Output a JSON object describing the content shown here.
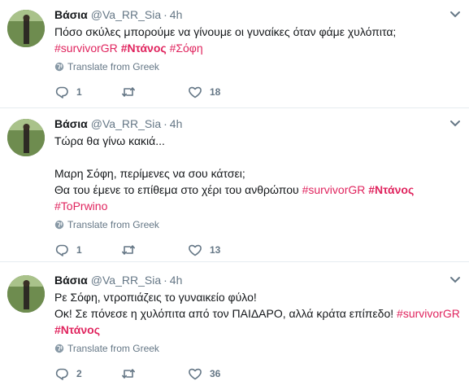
{
  "tweets": [
    {
      "name": "Βάσια",
      "handle": "@Va_RR_Sia",
      "separator": "·",
      "time": "4h",
      "lines": [
        [
          {
            "t": "Πόσο σκύλες μπορούμε να γίνουμε οι γυναίκες όταν φάμε χυλόπιτα;",
            "k": "text"
          }
        ],
        [
          {
            "t": "#survivorGR",
            "k": "tag"
          },
          {
            "t": " ",
            "k": "text"
          },
          {
            "t": "#Ντάνος",
            "k": "tagb"
          },
          {
            "t": " ",
            "k": "text"
          },
          {
            "t": "#Σόφη",
            "k": "tag"
          }
        ]
      ],
      "translate": "Translate from Greek",
      "reply_count": "1",
      "retweet_count": "",
      "like_count": "18"
    },
    {
      "name": "Βάσια",
      "handle": "@Va_RR_Sia",
      "separator": "·",
      "time": "4h",
      "lines": [
        [
          {
            "t": "Τώρα θα γίνω κακιά...",
            "k": "text"
          }
        ],
        [],
        [
          {
            "t": "Μαρη Σόφη, περίμενες να σου κάτσει;",
            "k": "text"
          }
        ],
        [
          {
            "t": "Θα του έμενε το επίθεμα στο χέρι του ανθρώπου ",
            "k": "text"
          },
          {
            "t": "#survivorGR",
            "k": "tag"
          },
          {
            "t": " ",
            "k": "text"
          },
          {
            "t": "#Ντάνος",
            "k": "tagb"
          }
        ],
        [
          {
            "t": "#ToPrwino",
            "k": "tag"
          }
        ]
      ],
      "translate": "Translate from Greek",
      "reply_count": "1",
      "retweet_count": "",
      "like_count": "13"
    },
    {
      "name": "Βάσια",
      "handle": "@Va_RR_Sia",
      "separator": "·",
      "time": "4h",
      "lines": [
        [
          {
            "t": "Ρε Σόφη, ντροπιάζεις το γυναικείο φύλο!",
            "k": "text"
          }
        ],
        [
          {
            "t": "Οκ! Σε πόνεσε η χυλόπιτα από τον ΠΑΙΔΑΡΟ, αλλά κράτα επίπεδο! ",
            "k": "text"
          },
          {
            "t": "#survivorGR",
            "k": "tag"
          }
        ],
        [
          {
            "t": "#Ντάνος",
            "k": "tagb"
          }
        ]
      ],
      "translate": "Translate from Greek",
      "reply_count": "2",
      "retweet_count": "",
      "like_count": "36"
    }
  ],
  "icons": {
    "reply": "reply-icon",
    "retweet": "retweet-icon",
    "like": "heart-icon",
    "globe": "globe-icon",
    "caret": "chevron-down-icon",
    "avatar": "avatar"
  },
  "colors": {
    "hashtag": "#e0245e",
    "muted": "#657786",
    "text": "#14171a",
    "divider": "#e6ecf0"
  }
}
